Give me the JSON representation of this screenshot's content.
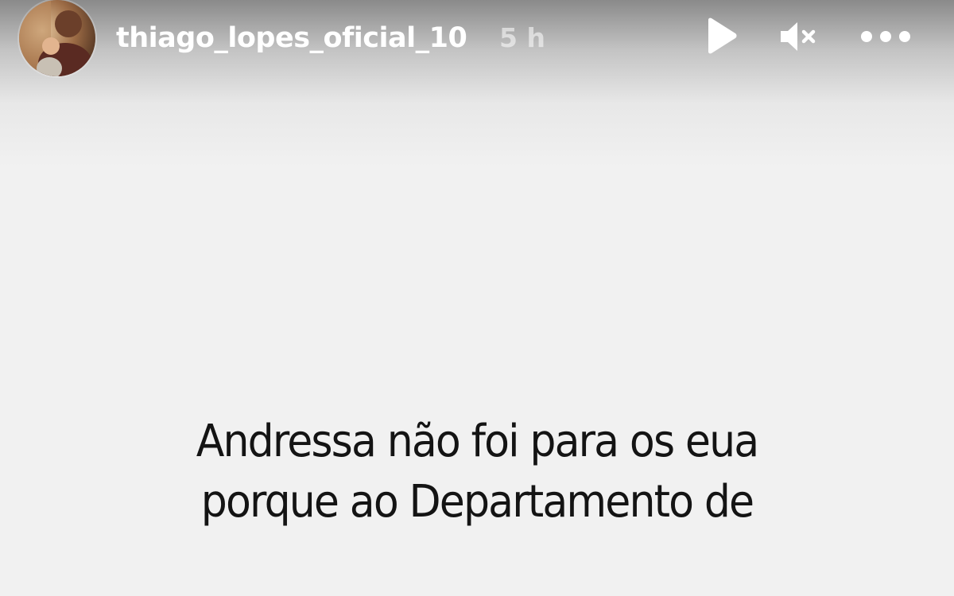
{
  "story": {
    "author": {
      "username": "thiago_lopes_oficial_10",
      "time_ago": "5 h",
      "avatar_icon": "profile-photo"
    },
    "controls": {
      "play_icon": "play-icon",
      "mute_icon": "speaker-muted-icon",
      "more_icon": "more-options-icon"
    },
    "caption_lines": [
      "Andressa não foi para os eua",
      "porque ao Departamento de"
    ]
  },
  "colors": {
    "background": "#f1f1f1",
    "header_text": "#ffffff",
    "caption_text": "#141414"
  }
}
